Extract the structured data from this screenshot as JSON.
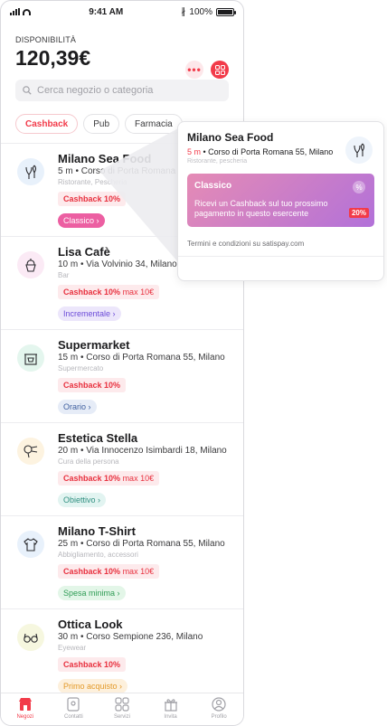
{
  "status": {
    "time": "9:41 AM",
    "battery": "100%",
    "battery_level": 1.0
  },
  "header": {
    "label": "DISPONIBILITÀ",
    "balance": "120,39€",
    "more_label": "•••",
    "qr_icon": "qr-code-icon"
  },
  "search": {
    "placeholder": "Cerca negozio o categoria"
  },
  "chips": [
    "Cashback",
    "Pub",
    "Farmacia"
  ],
  "items": [
    {
      "name": "Milano Sea Food",
      "addr": "5 m • Corso di Porta Romana 55, Milano",
      "cat": "Ristorante, Pescheria",
      "cashback": "Cashback 10%",
      "max": "",
      "tag": "Classico ›",
      "icon": "fish-hand-icon",
      "avatar_bg": "#e8f1fb",
      "tag_bg": "#ec5fa2",
      "tag_fg": "#ffffff"
    },
    {
      "name": "Lisa Cafè",
      "addr": "10 m • Via Volvinio 34, Milano",
      "cat": "Bar",
      "cashback": "Cashback 10%",
      "max": "max 10€",
      "tag": "Incrementale ›",
      "icon": "cupcake-icon",
      "avatar_bg": "#fbeaf5",
      "tag_bg": "#ece6fb",
      "tag_fg": "#6b4bd8"
    },
    {
      "name": "Supermarket",
      "addr": "15 m • Corso di Porta Romana 55, Milano",
      "cat": "Supermercato",
      "cashback": "Cashback 10%",
      "max": "",
      "tag": "Orario ›",
      "icon": "shop-icon",
      "avatar_bg": "#e4f6ee",
      "tag_bg": "#e6ecf7",
      "tag_fg": "#3f5f9f"
    },
    {
      "name": "Estetica Stella",
      "addr": "20 m • Via Innocenzo Isimbardi 18, Milano",
      "cat": "Cura della persona",
      "cashback": "Cashback 10%",
      "max": "max 10€",
      "tag": "Obiettivo ›",
      "icon": "hairdryer-icon",
      "avatar_bg": "#fdf3e0",
      "tag_bg": "#e2f4f1",
      "tag_fg": "#2f8f80"
    },
    {
      "name": "Milano T-Shirt",
      "addr": "25 m • Corso di Porta Romana 55, Milano",
      "cat": "Abbigliamento, accessori",
      "cashback": "Cashback 10%",
      "max": "max 10€",
      "tag": "Spesa minima ›",
      "icon": "tshirt-icon",
      "avatar_bg": "#e8f1fb",
      "tag_bg": "#e3f6e8",
      "tag_fg": "#2f9c55"
    },
    {
      "name": "Ottica Look",
      "addr": "30 m • Corso Sempione 236, Milano",
      "cat": "Eyewear",
      "cashback": "Cashback 10%",
      "max": "",
      "tag": "Primo acquisto ›",
      "icon": "glasses-icon",
      "avatar_bg": "#f6f7df",
      "tag_bg": "#fdf0dc",
      "tag_fg": "#e39a2a"
    }
  ],
  "tabs": [
    {
      "label": "Negozi",
      "icon": "store-icon",
      "active": true
    },
    {
      "label": "Contatti",
      "icon": "contacts-icon",
      "active": false
    },
    {
      "label": "Servizi",
      "icon": "grid-icon",
      "active": false
    },
    {
      "label": "Invita",
      "icon": "gift-icon",
      "active": false
    },
    {
      "label": "Profilo",
      "icon": "profile-icon",
      "active": false
    }
  ],
  "card": {
    "name": "Milano Sea Food",
    "distance": "5 m",
    "address": " • Corso di Porta Romana 55, Milano",
    "category": "Ristorante, pescheria",
    "promo_title": "Classico",
    "promo_desc": "Ricevi un Cashback sul tuo prossimo pagamento in questo esercente",
    "promo_badge": "20%",
    "promo_pct": "%",
    "terms": "Termini e condizioni su satispay.com"
  },
  "colors": {
    "accent": "#f23b4a",
    "promo_from": "#e58bb5",
    "promo_to": "#b271d9"
  }
}
